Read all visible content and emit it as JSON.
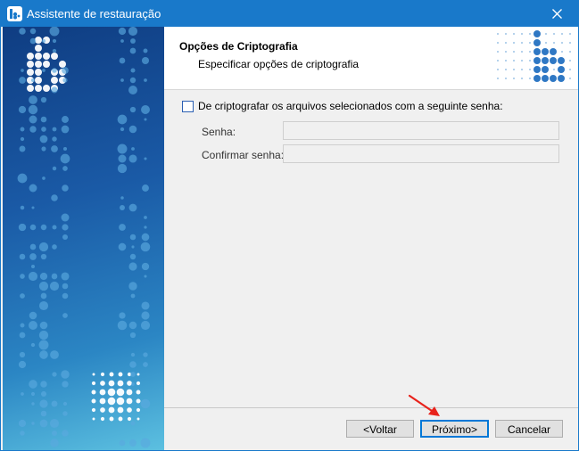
{
  "window": {
    "title": "Assistente de restauração"
  },
  "header": {
    "title": "Opções de Criptografia",
    "subtitle": "Especificar opções de criptografia"
  },
  "encryption": {
    "checkbox_label": "De criptografar os arquivos selecionados com a seguinte senha:",
    "checked": false,
    "password_label": "Senha:",
    "password_value": "",
    "confirm_label": "Confirmar senha:",
    "confirm_value": ""
  },
  "buttons": {
    "back": "<Voltar",
    "next": "Próximo>",
    "cancel": "Cancelar"
  },
  "colors": {
    "titlebar": "#1979ca",
    "arrow": "#e8221b"
  },
  "icons": [
    "app-logo-icon",
    "close-icon",
    "checkbox-icon",
    "arrow-annotation-icon"
  ]
}
